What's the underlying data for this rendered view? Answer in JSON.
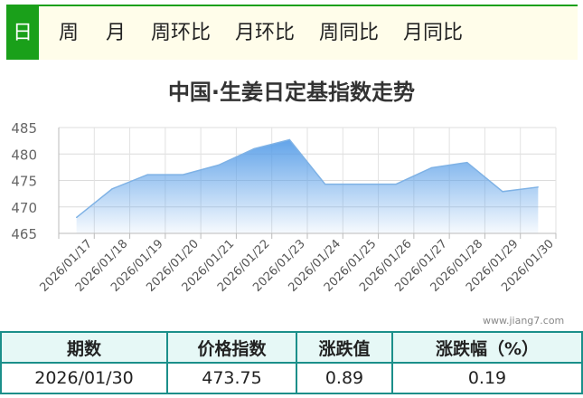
{
  "tabs": [
    {
      "label": "日",
      "active": true
    },
    {
      "label": "周",
      "active": false
    },
    {
      "label": "月",
      "active": false
    },
    {
      "label": "周环比",
      "active": false
    },
    {
      "label": "月环比",
      "active": false
    },
    {
      "label": "周同比",
      "active": false
    },
    {
      "label": "月同比",
      "active": false
    }
  ],
  "watermark": "www.jiang7.com",
  "colors": {
    "accent": "#1aa01a",
    "line": "#7fb2e5",
    "fill": "#a8cff5",
    "table_border": "#1b8f8a",
    "table_header": "#e6f8f6"
  },
  "chart_data": {
    "type": "area",
    "title": "中国·生姜日定基指数走势",
    "xlabel": "",
    "ylabel": "",
    "x": [
      "2026/01/17",
      "2026/01/18",
      "2026/01/19",
      "2026/01/20",
      "2026/01/21",
      "2026/01/22",
      "2026/01/23",
      "2026/01/24",
      "2026/01/25",
      "2026/01/26",
      "2026/01/27",
      "2026/01/28",
      "2026/01/29",
      "2026/01/30"
    ],
    "values": [
      468.0,
      473.4,
      476.1,
      476.1,
      477.9,
      481.0,
      482.7,
      474.3,
      474.3,
      474.3,
      477.4,
      478.4,
      472.9,
      473.75
    ],
    "ylim": [
      465,
      485
    ],
    "yticks": [
      465,
      470,
      475,
      480,
      485
    ],
    "grid": true,
    "legend": "none"
  },
  "summary": {
    "headers": [
      "期数",
      "价格指数",
      "涨跌值",
      "涨跌幅（%）"
    ],
    "row": [
      "2026/01/30",
      "473.75",
      "0.89",
      "0.19"
    ]
  }
}
